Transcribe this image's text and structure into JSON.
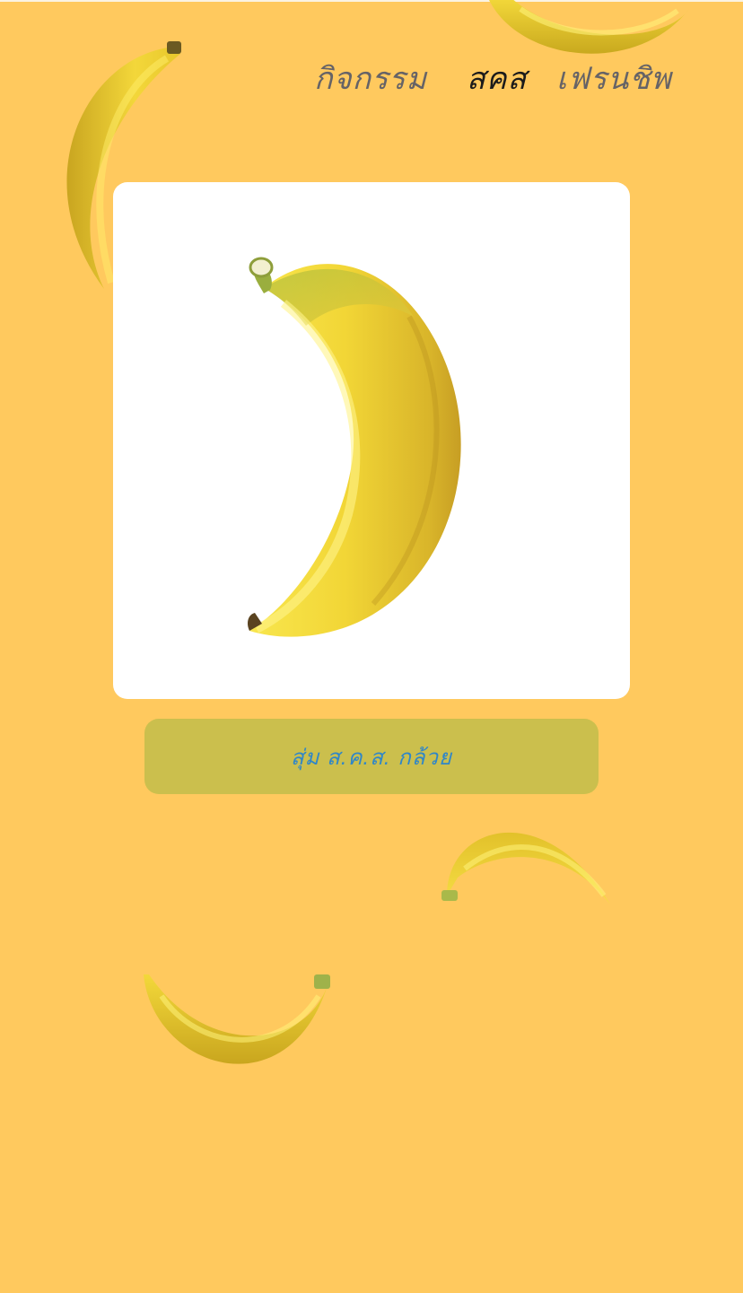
{
  "nav": {
    "items": [
      {
        "label": "กิจกรรม"
      },
      {
        "label": "สคส"
      },
      {
        "label": "เฟรนชิพ"
      }
    ],
    "active": "สคส"
  },
  "random_button": {
    "label": "สุ่ม ส.ค.ส. กล้วย"
  },
  "colors": {
    "background": "#FFC95E",
    "button": "#CBBF4D",
    "button_text": "#2F86C8",
    "card": "#FFFFFF"
  }
}
